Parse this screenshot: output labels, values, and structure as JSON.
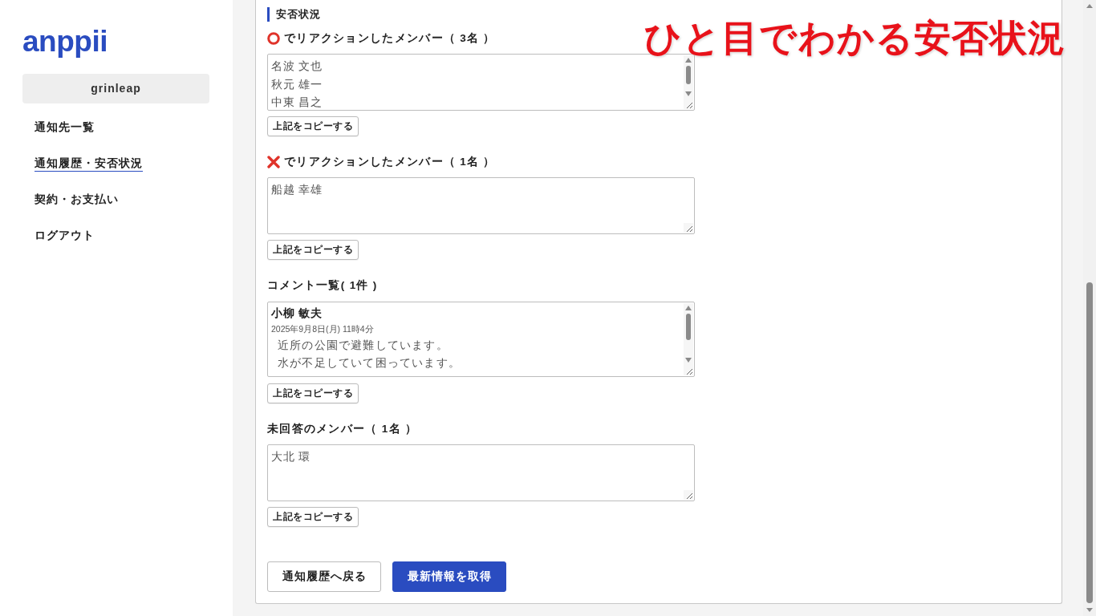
{
  "sidebar": {
    "logo": "anppii",
    "organization": "grinleap",
    "nav": [
      {
        "label": "通知先一覧",
        "selected": false
      },
      {
        "label": "通知履歴・安否状況",
        "selected": true
      },
      {
        "label": "契約・お支払い",
        "selected": false
      },
      {
        "label": "ログアウト",
        "selected": false
      }
    ]
  },
  "main": {
    "title": "安否状況",
    "sections": [
      {
        "kind": "ok",
        "heading": "でリアクションしたメンバー（ 3名 ）",
        "scrollable": true,
        "lines": [
          "名波 文也",
          "秋元 雄一",
          "中東 昌之"
        ],
        "copy_button": "上記をコピーする"
      },
      {
        "kind": "ng",
        "heading": "でリアクションしたメンバー（ 1名 ）",
        "scrollable": false,
        "lines": [
          "船越 幸雄"
        ],
        "copy_button": "上記をコピーする"
      },
      {
        "kind": "comments",
        "heading": "コメント一覧( 1件 )",
        "scrollable": true,
        "comments": [
          {
            "author": "小柳 敏夫",
            "time": "2025年9月8日(月) 11時4分",
            "lines": [
              "近所の公園で避難しています。",
              "水が不足していて困っています。"
            ]
          }
        ],
        "copy_button": "上記をコピーする"
      },
      {
        "kind": "members",
        "heading": "未回答のメンバー（ 1名 ）",
        "scrollable": false,
        "lines": [
          "大北 環"
        ],
        "copy_button": "上記をコピーする"
      }
    ],
    "buttons": [
      {
        "label": "通知履歴へ戻る",
        "kind": "secondary"
      },
      {
        "label": "最新情報を取得",
        "kind": "primary"
      }
    ]
  },
  "caption": "ひと目でわかる安否状況"
}
